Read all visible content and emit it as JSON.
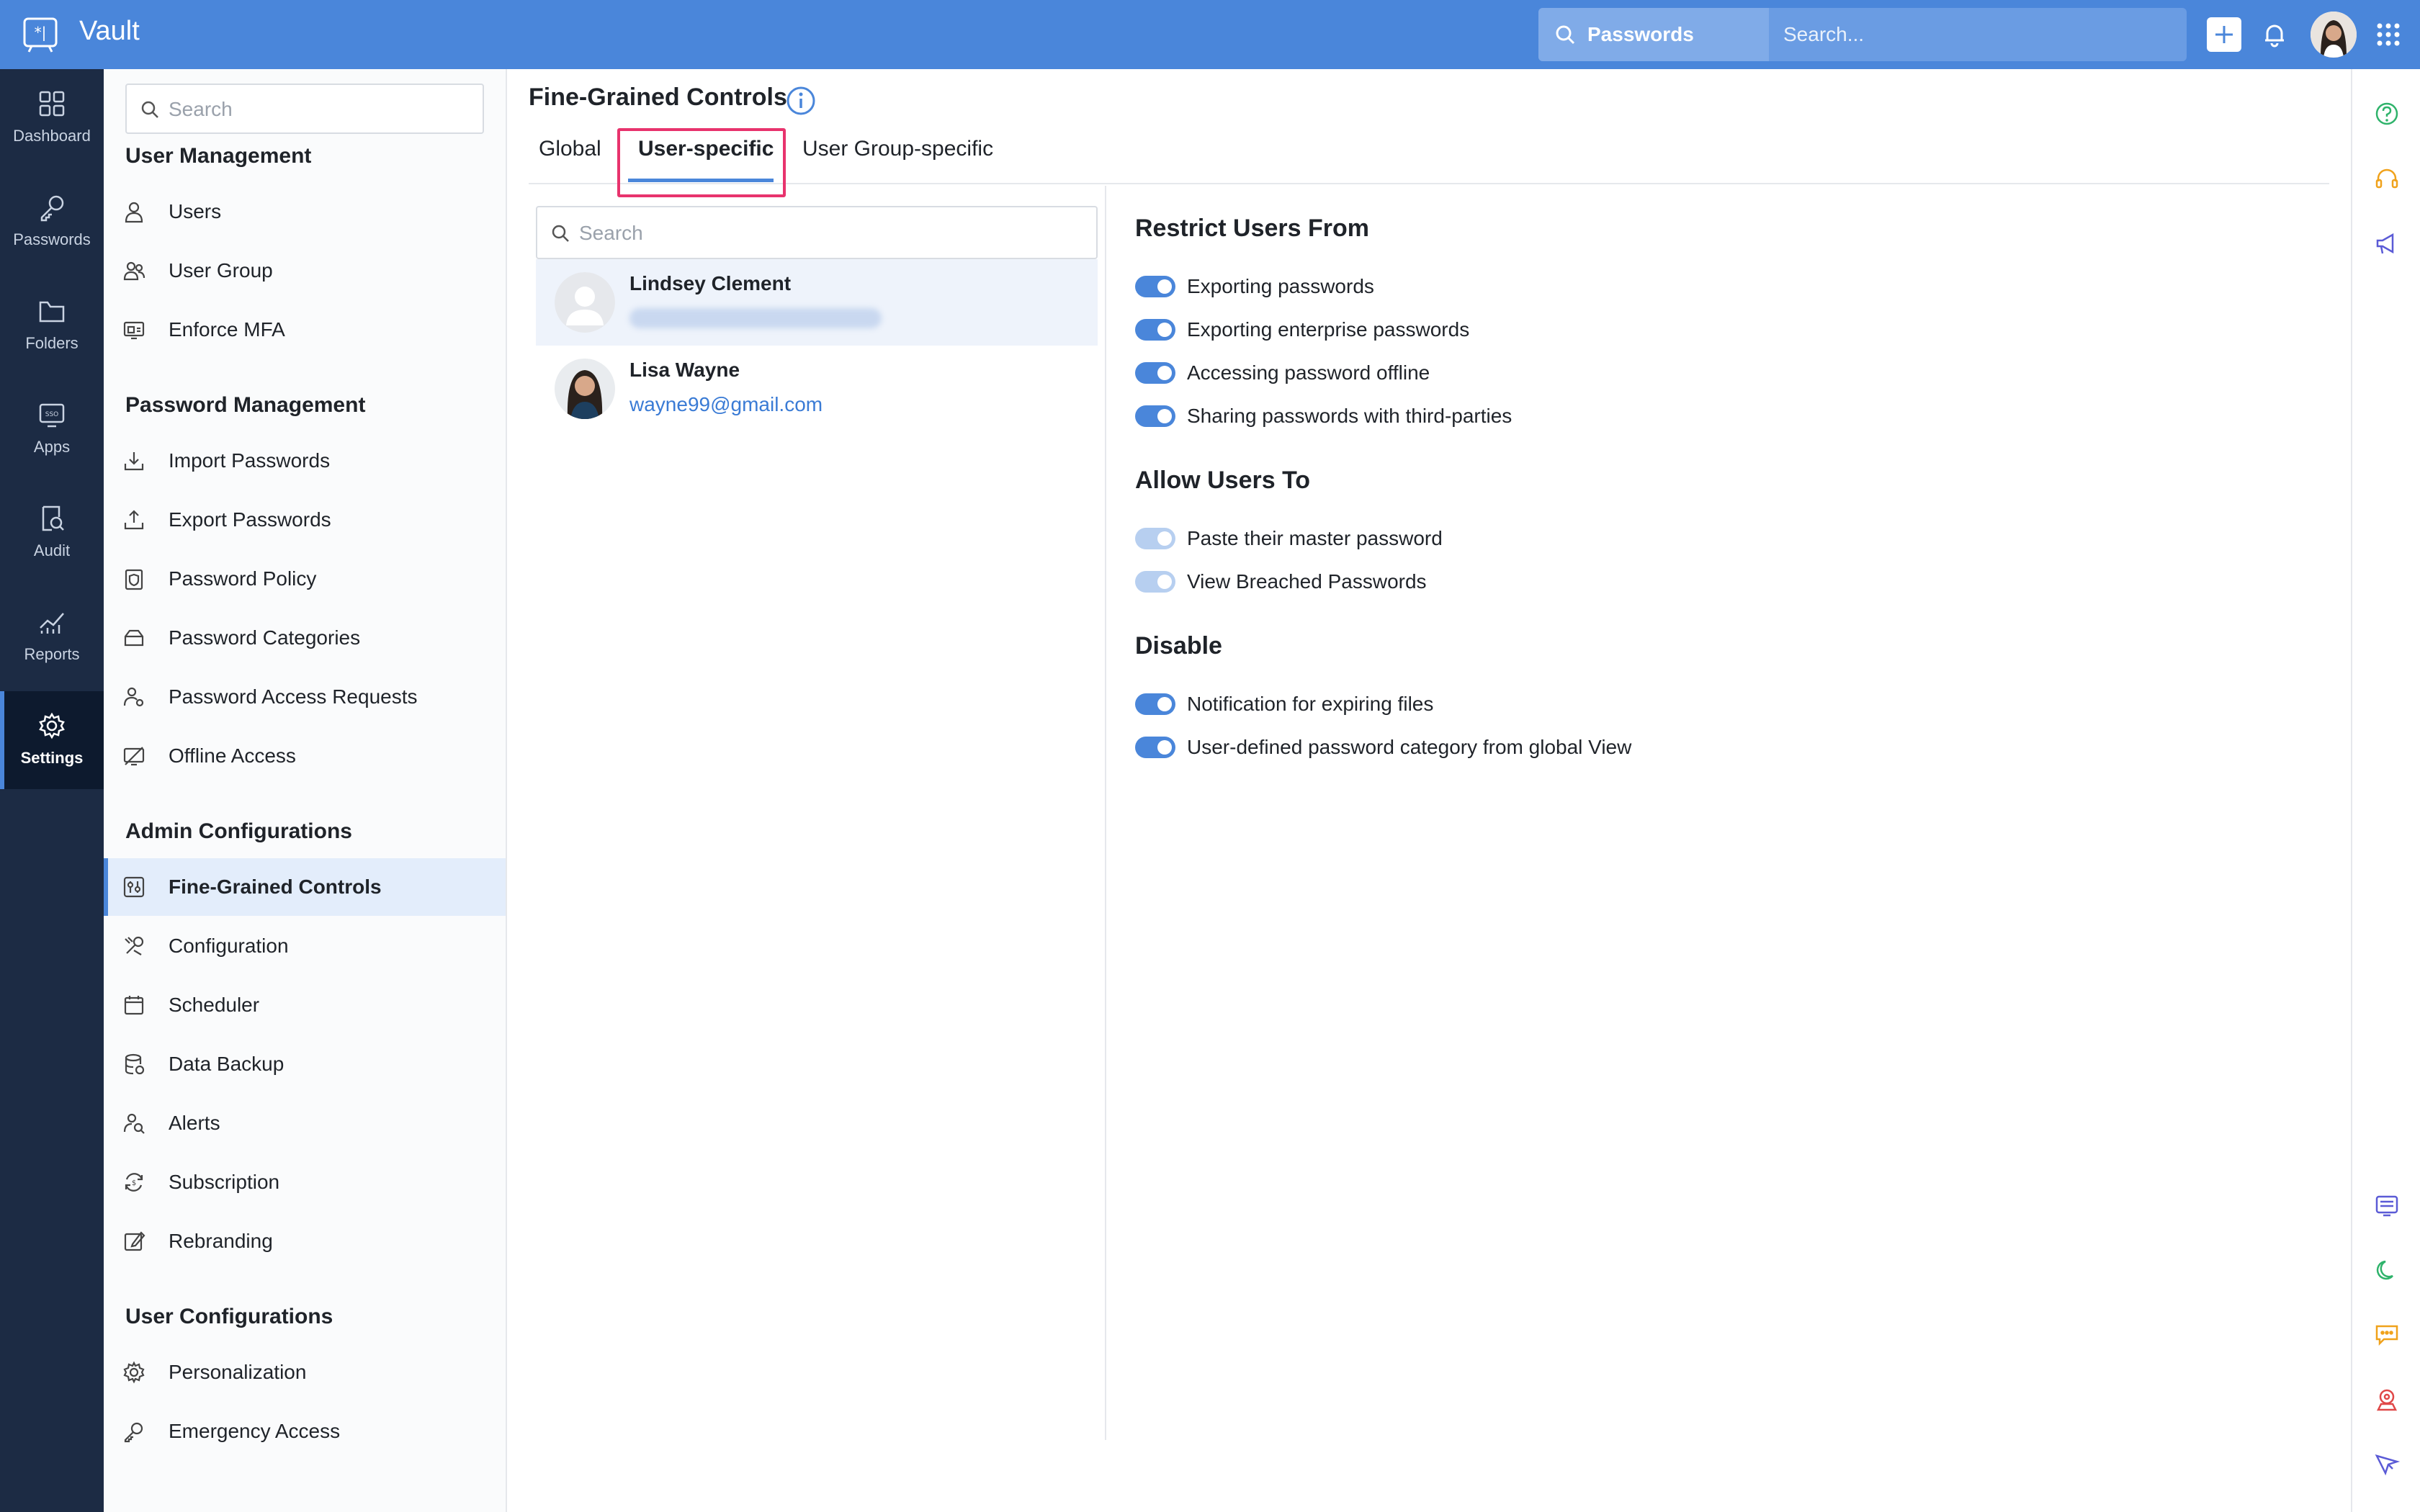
{
  "topbar": {
    "app_title": "Vault",
    "search_scope": "Passwords",
    "search_placeholder": "Search..."
  },
  "leftnav": {
    "items": [
      {
        "label": "Dashboard",
        "icon": "dashboard-icon"
      },
      {
        "label": "Passwords",
        "icon": "key-icon"
      },
      {
        "label": "Folders",
        "icon": "folder-icon"
      },
      {
        "label": "Apps",
        "icon": "sso-icon"
      },
      {
        "label": "Audit",
        "icon": "audit-icon"
      },
      {
        "label": "Reports",
        "icon": "reports-icon"
      },
      {
        "label": "Settings",
        "icon": "gear-icon",
        "active": true
      }
    ]
  },
  "sidebar": {
    "search_placeholder": "Search",
    "sections": [
      {
        "title": "User Management",
        "items": [
          "Users",
          "User Group",
          "Enforce MFA"
        ]
      },
      {
        "title": "Password Management",
        "items": [
          "Import Passwords",
          "Export Passwords",
          "Password Policy",
          "Password Categories",
          "Password Access Requests",
          "Offline Access"
        ]
      },
      {
        "title": "Admin Configurations",
        "items": [
          "Fine-Grained Controls",
          "Configuration",
          "Scheduler",
          "Data Backup",
          "Alerts",
          "Subscription",
          "Rebranding"
        ]
      },
      {
        "title": "User Configurations",
        "items": [
          "Personalization",
          "Emergency Access"
        ]
      }
    ],
    "active_item": "Fine-Grained Controls"
  },
  "main": {
    "title": "Fine-Grained Controls",
    "tabs": [
      "Global",
      "User-specific",
      "User Group-specific"
    ],
    "active_tab": "User-specific",
    "user_search_placeholder": "Search",
    "users": [
      {
        "name": "Lindsey Clement",
        "email": "",
        "selected": true
      },
      {
        "name": "Lisa Wayne",
        "email": "wayne99@gmail.com",
        "selected": false
      }
    ],
    "groups": [
      {
        "title": "Restrict Users From",
        "options": [
          {
            "label": "Exporting passwords",
            "on": true
          },
          {
            "label": "Exporting enterprise passwords",
            "on": true
          },
          {
            "label": "Accessing password offline",
            "on": true
          },
          {
            "label": "Sharing passwords with third-parties",
            "on": true
          }
        ]
      },
      {
        "title": "Allow Users To",
        "options": [
          {
            "label": "Paste their master password",
            "on": true,
            "disabled": true
          },
          {
            "label": "View Breached Passwords",
            "on": true,
            "disabled": true
          }
        ]
      },
      {
        "title": "Disable",
        "options": [
          {
            "label": "Notification for expiring files",
            "on": true
          },
          {
            "label": "User-defined password category from global View",
            "on": true
          }
        ]
      }
    ]
  },
  "colors": {
    "topbar": "#4a86da",
    "nav": "#1c2b44",
    "accent": "#4a86da",
    "highlight": "#e8336d"
  }
}
